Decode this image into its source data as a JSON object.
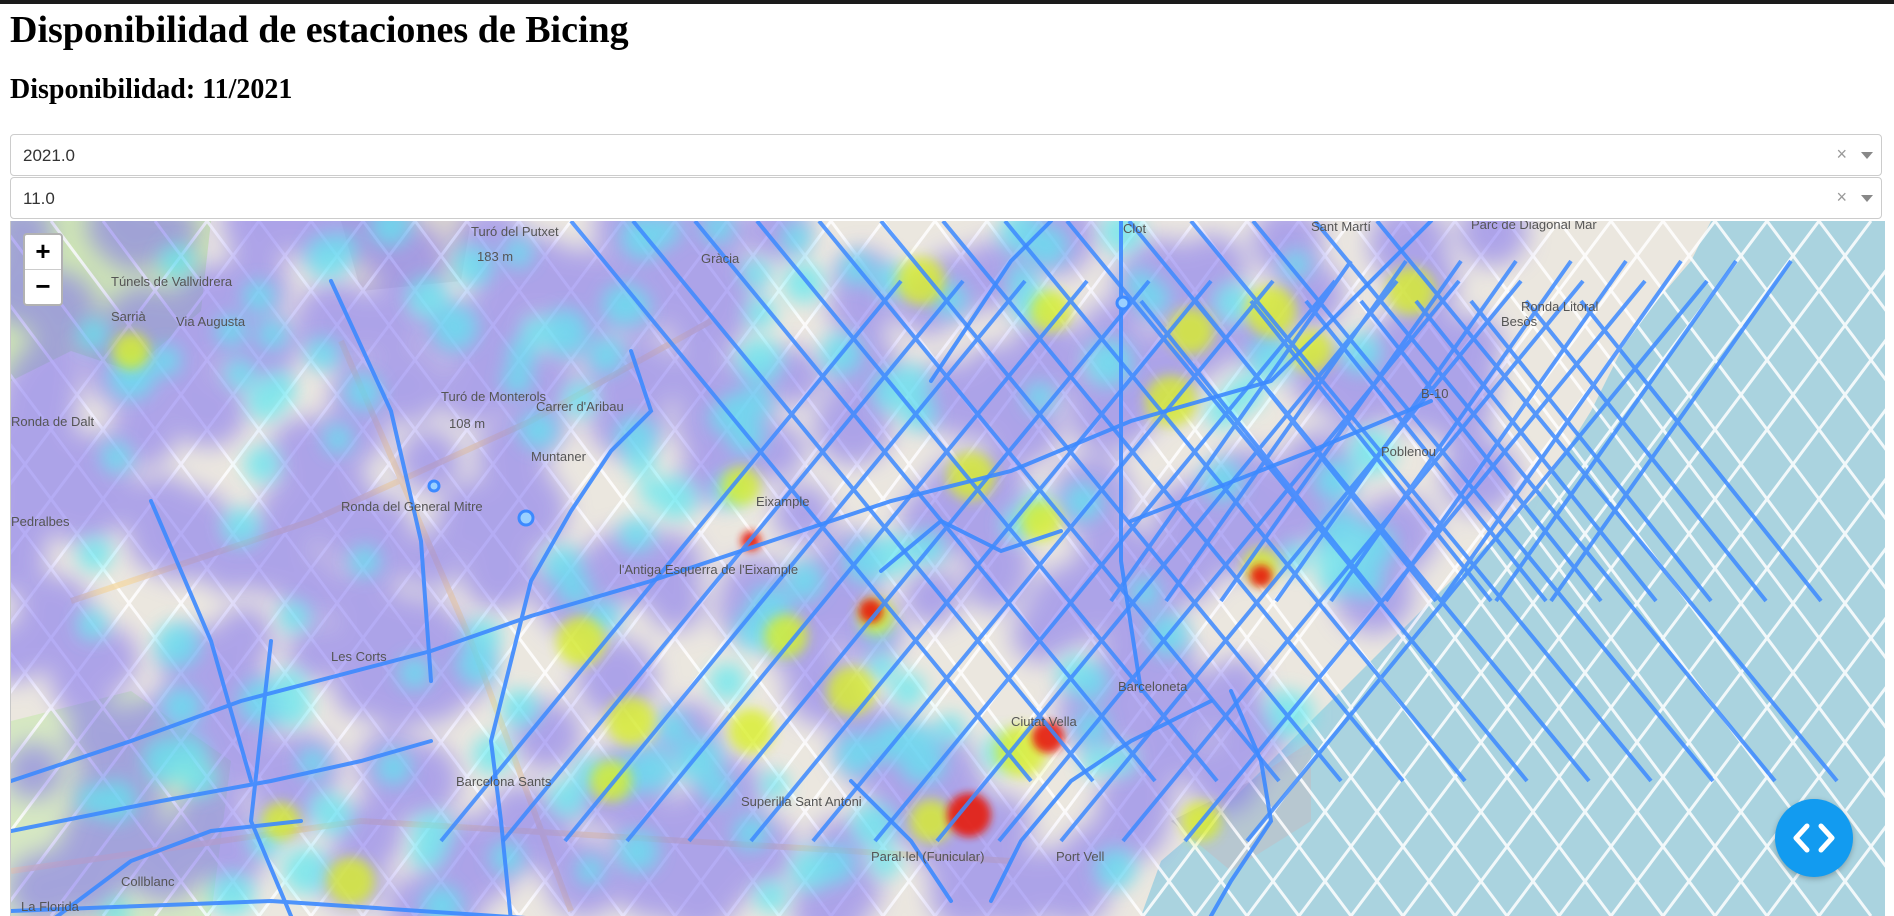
{
  "header": {
    "title": "Disponibilidad de estaciones de Bicing",
    "subtitle": "Disponibilidad: 11/2021"
  },
  "filters": {
    "year": {
      "value": "2021.0",
      "clear_symbol": "×"
    },
    "month": {
      "value": "11.0",
      "clear_symbol": "×"
    }
  },
  "map": {
    "zoom_in_label": "+",
    "zoom_out_label": "−",
    "layer": "heatmap",
    "labels": [
      "Gràcia",
      "Clot",
      "Sant Martí",
      "Parc de Diagonal Mar",
      "Turó del Putxet",
      "183 m",
      "Túnels de Vallvidrera",
      "Sarrià",
      "Via Augusta",
      "Turó de Monterols",
      "108 m",
      "Carrer d'Aribau",
      "Muntaner",
      "Ronda del General Mitre",
      "l'Antiga Esquerra de l'Eixample",
      "Eixample",
      "Les Corts",
      "Barcelona Sants",
      "Ciutat Vella",
      "Port Vell",
      "Poblenou",
      "Besòs",
      "B-10",
      "Ronda Litoral",
      "Barceloneta",
      "Collblanc",
      "La Florida",
      "Paral·lel (Funicular)",
      "Superilla Sant Antoni",
      "Pedralbes",
      "Ronda de Dalt"
    ]
  },
  "code_button_icon": "code-icon",
  "colors": {
    "water": "#aad3df",
    "heat_low": "#7a6cf0",
    "heat_mid": "#5de8f0",
    "heat_high": "#d9ef2a",
    "heat_max": "#e61f0a",
    "bike_lanes": "#3d8aff",
    "code_button": "#129bf0"
  }
}
